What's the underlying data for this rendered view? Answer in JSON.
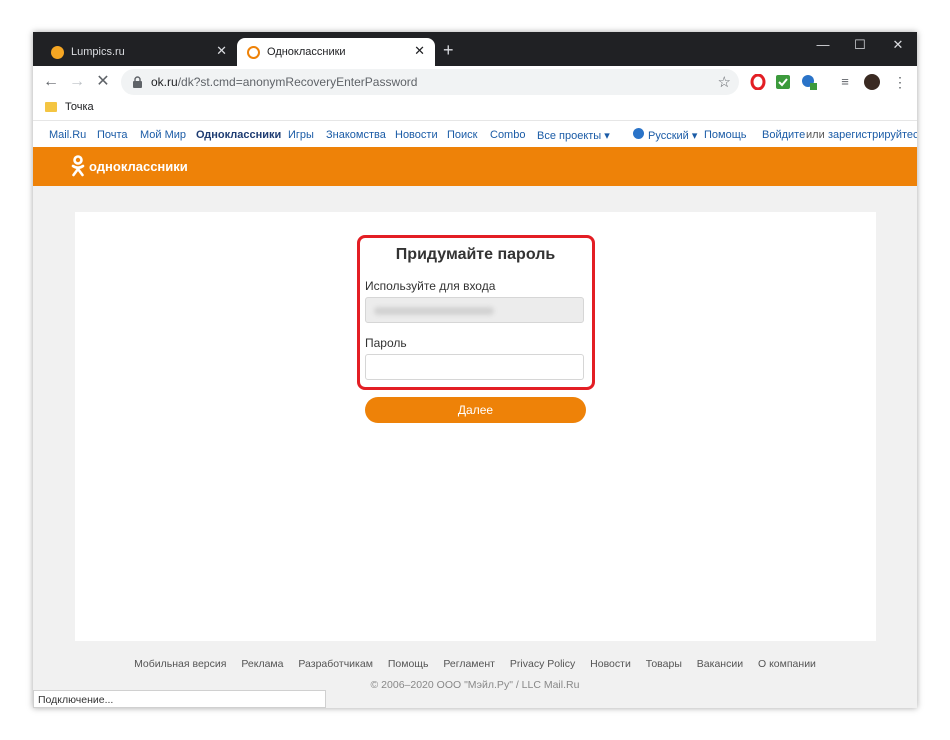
{
  "browser": {
    "tabs": [
      {
        "title": "Lumpics.ru",
        "favicon_color": "#f5a623"
      },
      {
        "title": "Одноклассники",
        "favicon_color": "#ee8208"
      }
    ],
    "new_tab": "+",
    "controls": {
      "minimize": "—",
      "maximize": "☐",
      "close": "✕"
    },
    "url_host": "ok.ru",
    "url_path": "/dk?st.cmd=anonymRecoveryEnterPassword",
    "bookmark": "Точка",
    "status": "Подключение..."
  },
  "portal_nav": {
    "links": [
      "Mail.Ru",
      "Почта",
      "Мой Мир",
      "Одноклассники",
      "Игры",
      "Знакомства",
      "Новости",
      "Поиск",
      "Combo",
      "Все проекты ▾"
    ],
    "language": "Русский ▾",
    "help": "Помощь",
    "login": "Войдите",
    "or": "или",
    "register": "зарегистрируйтесь"
  },
  "header": {
    "site_name": "одноклассники",
    "brand_color": "#ee8208"
  },
  "form": {
    "title": "Придумайте пароль",
    "login_label": "Используйте для входа",
    "password_label": "Пароль",
    "submit": "Далее"
  },
  "footer": {
    "links": [
      "Мобильная версия",
      "Реклама",
      "Разработчикам",
      "Помощь",
      "Регламент",
      "Privacy Policy",
      "Новости",
      "Товары",
      "Вакансии",
      "О компании"
    ],
    "copyright": "© 2006–2020 ООО \"Мэйл.Ру\" / LLC Mail.Ru"
  }
}
